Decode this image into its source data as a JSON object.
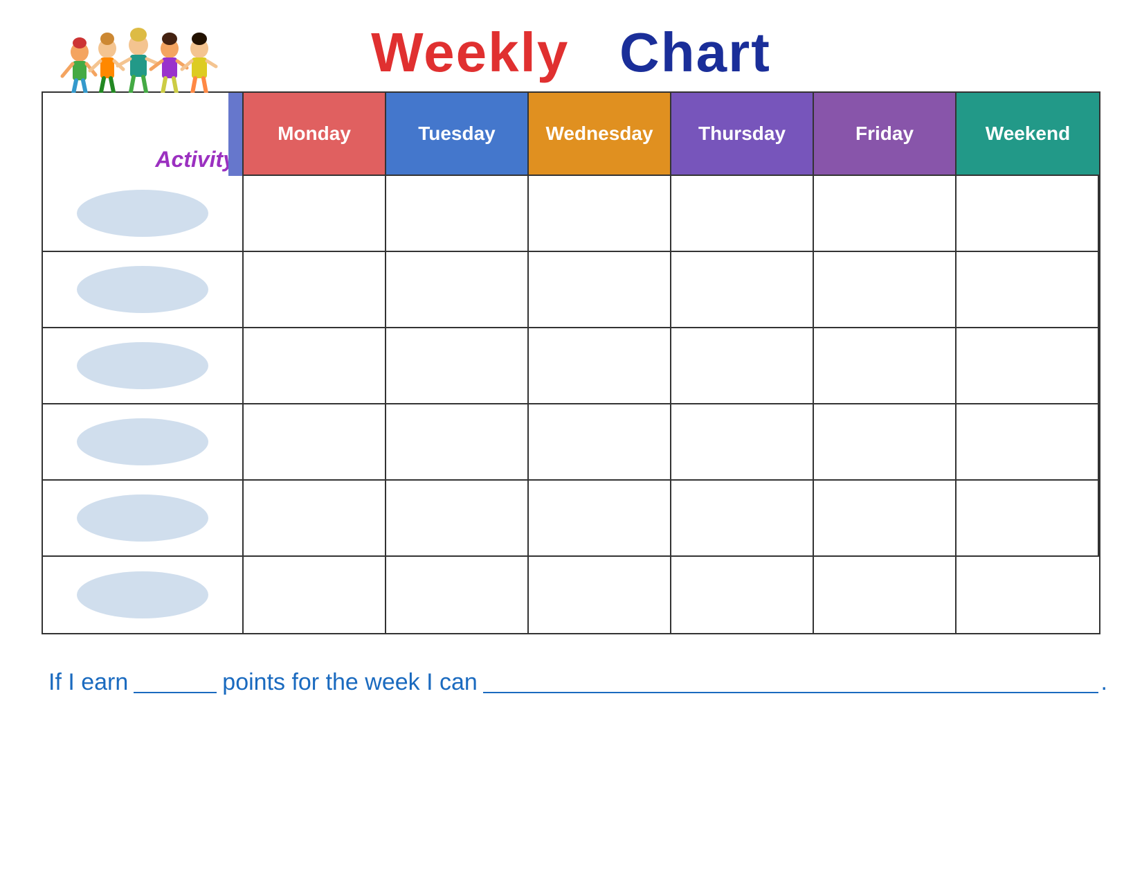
{
  "title": {
    "weekly": "Weekly",
    "chart": "Chart"
  },
  "header": {
    "activity_label": "Activity",
    "days": [
      {
        "id": "monday",
        "label": "Monday",
        "class": "day-monday"
      },
      {
        "id": "tuesday",
        "label": "Tuesday",
        "class": "day-tuesday"
      },
      {
        "id": "wednesday",
        "label": "Wednesday",
        "class": "day-wednesday"
      },
      {
        "id": "thursday",
        "label": "Thursday",
        "class": "day-thursday"
      },
      {
        "id": "friday",
        "label": "Friday",
        "class": "day-friday"
      },
      {
        "id": "weekend",
        "label": "Weekend",
        "class": "day-weekend"
      }
    ]
  },
  "rows": 6,
  "footer": {
    "part1": "If I earn",
    "part2": "points for the week I can",
    "period": "."
  },
  "colors": {
    "monday": "#e06060",
    "tuesday": "#4477cc",
    "wednesday": "#e09020",
    "thursday": "#7755bb",
    "friday": "#8855aa",
    "weekend": "#229988",
    "activity_label": "#9b30c0",
    "title_weekly": "#e03030",
    "title_chart": "#1a2e99",
    "footer_text": "#1a6abf",
    "vertical_bar": "#6677cc",
    "oval": "#c8d8ea"
  }
}
